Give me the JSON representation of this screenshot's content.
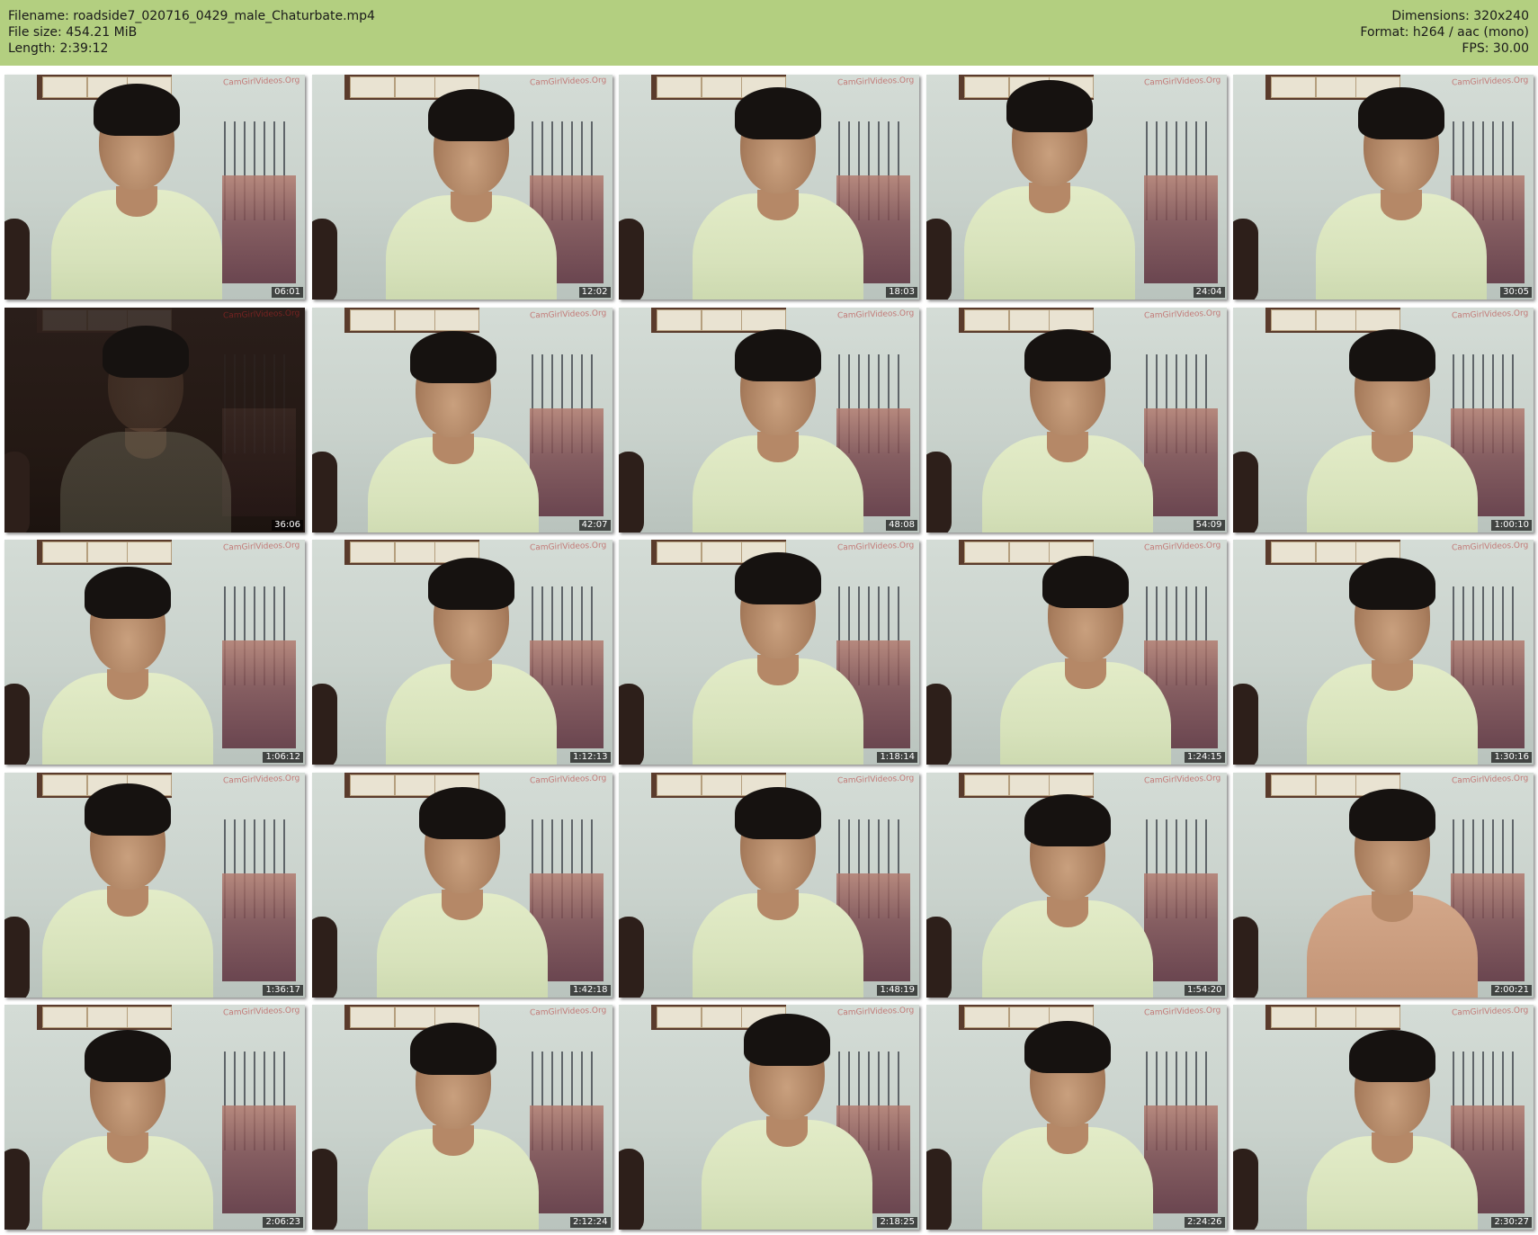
{
  "header": {
    "filename_label": "Filename: roadside7_020716_0429_male_Chaturbate.mp4",
    "file_size_label": "File size: 454.21 MiB",
    "length_label": "Length: 2:39:12",
    "dimensions_label": "Dimensions: 320x240",
    "format_label": "Format: h264 / aac (mono)",
    "fps_label": "FPS: 30.00",
    "background_color": "#b3cf80"
  },
  "thumbnails": [
    {
      "timestamp": "06:01",
      "watermark": "CamGirlVideos.Org"
    },
    {
      "timestamp": "12:02",
      "watermark": "CamGirlVideos.Org"
    },
    {
      "timestamp": "18:03",
      "watermark": "CamGirlVideos.Org"
    },
    {
      "timestamp": "24:04",
      "watermark": "CamGirlVideos.Org"
    },
    {
      "timestamp": "30:05",
      "watermark": "CamGirlVideos.Org"
    },
    {
      "timestamp": "36:06",
      "watermark": "CamGirlVideos.Org"
    },
    {
      "timestamp": "42:07",
      "watermark": "CamGirlVideos.Org"
    },
    {
      "timestamp": "48:08",
      "watermark": "CamGirlVideos.Org"
    },
    {
      "timestamp": "54:09",
      "watermark": "CamGirlVideos.Org"
    },
    {
      "timestamp": "1:00:10",
      "watermark": "CamGirlVideos.Org"
    },
    {
      "timestamp": "1:06:12",
      "watermark": "CamGirlVideos.Org"
    },
    {
      "timestamp": "1:12:13",
      "watermark": "CamGirlVideos.Org"
    },
    {
      "timestamp": "1:18:14",
      "watermark": "CamGirlVideos.Org"
    },
    {
      "timestamp": "1:24:15",
      "watermark": "CamGirlVideos.Org"
    },
    {
      "timestamp": "1:30:16",
      "watermark": "CamGirlVideos.Org"
    },
    {
      "timestamp": "1:36:17",
      "watermark": "CamGirlVideos.Org"
    },
    {
      "timestamp": "1:42:18",
      "watermark": "CamGirlVideos.Org"
    },
    {
      "timestamp": "1:48:19",
      "watermark": "CamGirlVideos.Org"
    },
    {
      "timestamp": "1:54:20",
      "watermark": "CamGirlVideos.Org"
    },
    {
      "timestamp": "2:00:21",
      "watermark": "CamGirlVideos.Org"
    },
    {
      "timestamp": "2:06:23",
      "watermark": "CamGirlVideos.Org"
    },
    {
      "timestamp": "2:12:24",
      "watermark": "CamGirlVideos.Org"
    },
    {
      "timestamp": "2:18:25",
      "watermark": "CamGirlVideos.Org"
    },
    {
      "timestamp": "2:24:26",
      "watermark": "CamGirlVideos.Org"
    },
    {
      "timestamp": "2:30:27",
      "watermark": "CamGirlVideos.Org"
    }
  ]
}
